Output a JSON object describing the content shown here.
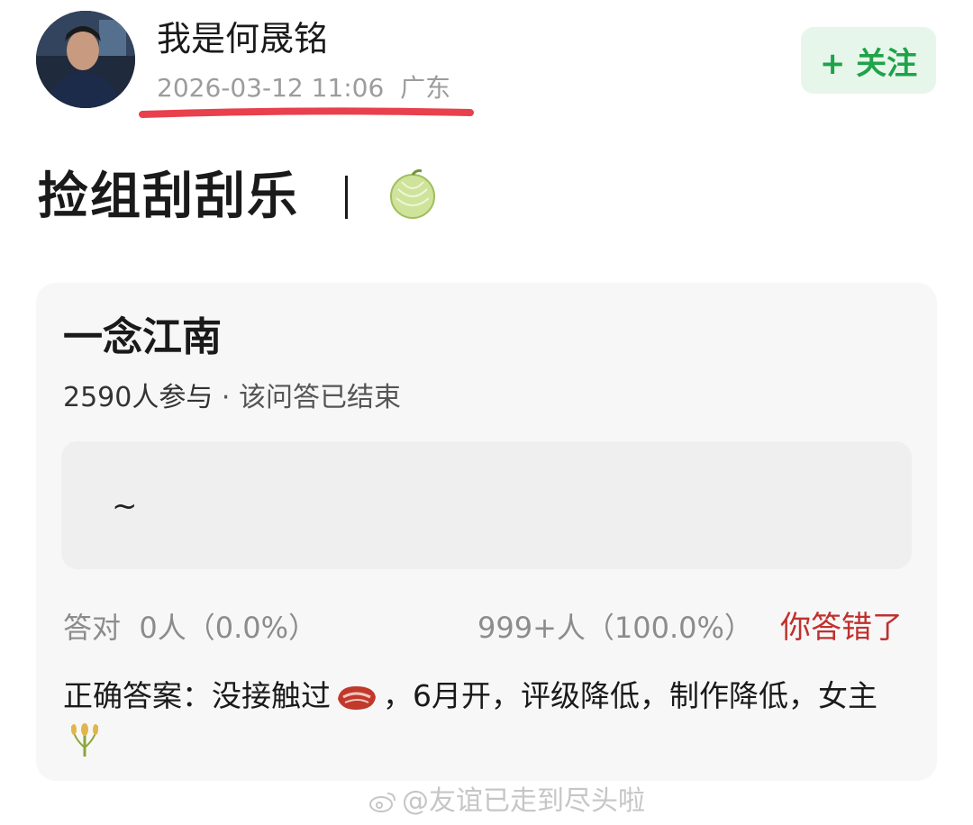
{
  "post": {
    "author_name": "我是何晟铭",
    "timestamp": "2026-03-12 11:06",
    "location": "广东",
    "follow_label": "+ 关注",
    "title": "捡组刮刮乐",
    "title_emoji": "melon-icon"
  },
  "quiz": {
    "title": "一念江南",
    "participants": "2590人参与",
    "status": "· 该问答已结束",
    "answer_placeholder": "~",
    "correct_stat": "答对  0人（0.0%）",
    "wrong_stat": "999+人（100.0%）",
    "result_label": "你答错了",
    "correct_answer_part1": "正确答案：没接触过",
    "correct_answer_part2": "，6月开，评级降低，制作降低，女主",
    "emoji_1": "meat-icon",
    "emoji_2": "rice-icon"
  },
  "colors": {
    "accent_green": "#1fa34a",
    "follow_bg": "#e7f6ea",
    "wrong_red": "#c0302e",
    "highlight_underline": "#e8404d"
  },
  "watermark": {
    "text": "@友谊已走到尽头啦",
    "icon": "weibo-icon"
  }
}
